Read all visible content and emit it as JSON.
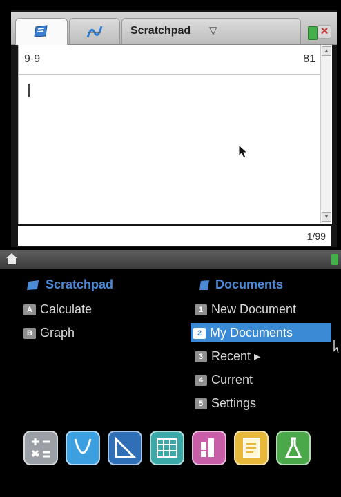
{
  "scratchpad_window": {
    "tab_label": "Scratchpad",
    "tab_dropdown_icon": "▽",
    "history": {
      "expression": "9·9",
      "result": "81"
    },
    "page_count": "1/99"
  },
  "home_menu": {
    "scratchpad": {
      "heading": "Scratchpad",
      "items": [
        {
          "key": "A",
          "label": "Calculate"
        },
        {
          "key": "B",
          "label": "Graph"
        }
      ]
    },
    "documents": {
      "heading": "Documents",
      "items": [
        {
          "key": "1",
          "label": "New Document"
        },
        {
          "key": "2",
          "label": "My Documents"
        },
        {
          "key": "3",
          "label": "Recent ▸"
        },
        {
          "key": "4",
          "label": "Current"
        },
        {
          "key": "5",
          "label": "Settings"
        }
      ]
    }
  },
  "app_icons": [
    {
      "name": "calculator-app-icon",
      "color": "#9aa0a6"
    },
    {
      "name": "graphs-app-icon",
      "color": "#3c9fe0"
    },
    {
      "name": "geometry-app-icon",
      "color": "#2f6fb8"
    },
    {
      "name": "lists-spreadsheet-app-icon",
      "color": "#3aa9a8"
    },
    {
      "name": "data-statistics-app-icon",
      "color": "#c85ea8"
    },
    {
      "name": "notes-app-icon",
      "color": "#e8b83a"
    },
    {
      "name": "vernier-dataquest-app-icon",
      "color": "#4aa84a"
    }
  ],
  "colors": {
    "accent": "#3a8ad6",
    "heading": "#4d8ad6",
    "background": "#000000"
  }
}
